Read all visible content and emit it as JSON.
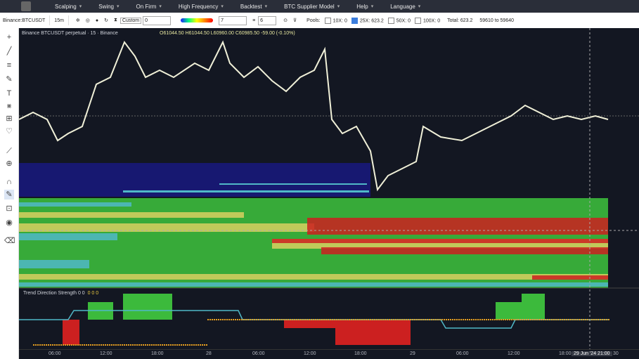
{
  "menu": {
    "items": [
      "Scalping",
      "Swing",
      "On Firm",
      "High Frequency",
      "Backtest",
      "BTC Supplier Model",
      "Help",
      "Language"
    ]
  },
  "toolbar": {
    "symbol": "Binance:BTCUSDT",
    "interval": "15m",
    "preset": "Custom",
    "preset_value": "0",
    "pct_value": "7",
    "levels_value": "6",
    "pools_label": "Pools:",
    "pool_10x": "10X: 0",
    "pool_25x": "25X: 623.2",
    "pool_50x": "50X: 0",
    "pool_100x": "100X: 0",
    "total": "Total: 623.2",
    "range": "59610 to 59640"
  },
  "chart": {
    "title": "Binance BTCUSDT perpetual · 15 · Binance",
    "ohlc": "O61044.50 H61044.50 L60960.00 C60985.50 -59.00 (-0.10%)",
    "indicator_label": "Trend Direction Strength 0 0",
    "indicator_values": "0 0 0",
    "cursor_date": "29 Jun '24",
    "cursor_time": "21:00",
    "xaxis": [
      "06:00",
      "12:00",
      "18:00",
      "28",
      "06:00",
      "12:00",
      "18:00",
      "29",
      "06:00",
      "12:00",
      "18:00",
      "30"
    ]
  },
  "colors": {
    "bg": "#131722",
    "green": "#3cba3c",
    "red": "#cc2020",
    "yellow": "#d8d060",
    "cyan": "#50b8c8",
    "blue": "#1a1a8c"
  }
}
